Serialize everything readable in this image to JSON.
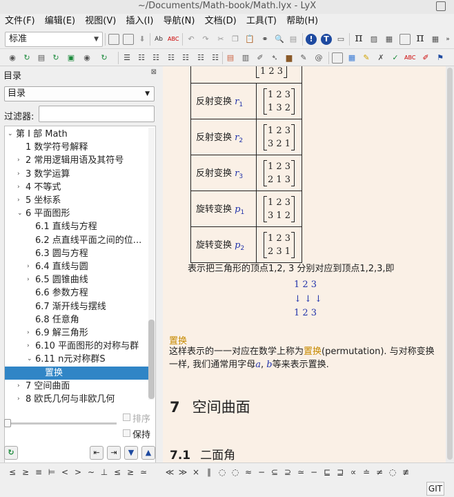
{
  "window": {
    "title": "~/Documents/Math-book/Math.lyx - LyX"
  },
  "menu": [
    "文件(F)",
    "编辑(E)",
    "视图(V)",
    "插入(I)",
    "导航(N)",
    "文档(D)",
    "工具(T)",
    "帮助(H)"
  ],
  "toolbar": {
    "style_value": "标准"
  },
  "outline": {
    "title": "目录",
    "type_value": "目录",
    "filter_label": "过滤器:",
    "filter_value": "",
    "items": [
      {
        "label": "第 I 部 Math",
        "level": 0,
        "arrow": "expanded"
      },
      {
        "label": "1 数学符号解释",
        "level": 1,
        "arrow": "none"
      },
      {
        "label": "2 常用逻辑用语及其符号",
        "level": 1,
        "arrow": "collapsed"
      },
      {
        "label": "3 数学运算",
        "level": 1,
        "arrow": "collapsed"
      },
      {
        "label": "4 不等式",
        "level": 1,
        "arrow": "collapsed"
      },
      {
        "label": "5 坐标系",
        "level": 1,
        "arrow": "collapsed"
      },
      {
        "label": "6 平面图形",
        "level": 1,
        "arrow": "expanded"
      },
      {
        "label": "6.1 直线与方程",
        "level": 2,
        "arrow": "none"
      },
      {
        "label": "6.2 点直线平面之间的位...",
        "level": 2,
        "arrow": "none"
      },
      {
        "label": "6.3 圆与方程",
        "level": 2,
        "arrow": "none"
      },
      {
        "label": "6.4 直线与圆",
        "level": 2,
        "arrow": "collapsed"
      },
      {
        "label": "6.5 圆锥曲线",
        "level": 2,
        "arrow": "collapsed"
      },
      {
        "label": "6.6 参数方程",
        "level": 2,
        "arrow": "none"
      },
      {
        "label": "6.7 渐开线与摆线",
        "level": 2,
        "arrow": "none"
      },
      {
        "label": "6.8 任意角",
        "level": 2,
        "arrow": "none"
      },
      {
        "label": "6.9 解三角形",
        "level": 2,
        "arrow": "collapsed"
      },
      {
        "label": "6.10 平面图形的对称与群",
        "level": 2,
        "arrow": "collapsed"
      },
      {
        "label": "6.11 n元对称群S",
        "level": 2,
        "arrow": "expanded"
      },
      {
        "label": "置换",
        "level": 3,
        "arrow": "none",
        "selected": true
      },
      {
        "label": "7 空间曲面",
        "level": 1,
        "arrow": "collapsed"
      },
      {
        "label": "8 欧氏几何与非欧几何",
        "level": 1,
        "arrow": "collapsed"
      }
    ],
    "sort_label": "排序",
    "keep_label": "保持"
  },
  "document": {
    "table_rows": [
      {
        "name": "反射变换",
        "var": "r",
        "sub": "1",
        "top": "1 2 3",
        "bottom": "1 3 2"
      },
      {
        "name": "反射变换",
        "var": "r",
        "sub": "2",
        "top": "1 2 3",
        "bottom": "3 2 1"
      },
      {
        "name": "反射变换",
        "var": "r",
        "sub": "3",
        "top": "1 2 3",
        "bottom": "2 1 3"
      },
      {
        "name": "旋转变换",
        "var": "p",
        "sub": "1",
        "top": "1 2 3",
        "bottom": "3 1 2"
      },
      {
        "name": "旋转变换",
        "var": "p",
        "sub": "2",
        "top": "1 2 3",
        "bottom": "2 3 1"
      }
    ],
    "partial_row_bottom": "1 2 3",
    "sentence": "表示把三角形的顶点1,2, 3 分别对应到顶点1,2,3,即",
    "display_top": "1 2 3",
    "display_arrows": "↓ ↓ ↓",
    "display_bottom": "1 2 3",
    "subheading": "置换",
    "para_1a": "这样表示的一一对应在数学上称为",
    "para_1b": "置换",
    "para_1c": "(permutation).  与对称变换",
    "para_2a": "一样, 我们通常用字母",
    "para_2b": "a",
    "para_2c": ", ",
    "para_2d": "b",
    "para_2e": "等来表示置换.",
    "section_num": "7",
    "section_title": "空间曲面",
    "subsection_num": "7.1",
    "subsection_title": "二面角"
  },
  "math_toolbar": [
    "≤",
    "≥",
    "≡",
    "⊨",
    "<",
    ">",
    "∼",
    "⊥",
    "≤",
    "≥",
    "≃",
    "",
    "≪",
    "≫",
    "×",
    "∥",
    "◌",
    "◌",
    "≈",
    "−",
    "⊆",
    "⊇",
    "≃",
    "−",
    "⊑",
    "⊒",
    "∝",
    "≐",
    "≠",
    "◌",
    "≢"
  ],
  "status": {
    "git_label": "GIT"
  },
  "colors": {
    "doc_bg": "#faf0e6",
    "selection": "#3085c6",
    "heading_accent": "#c78a00",
    "math_blue": "#2233aa"
  }
}
